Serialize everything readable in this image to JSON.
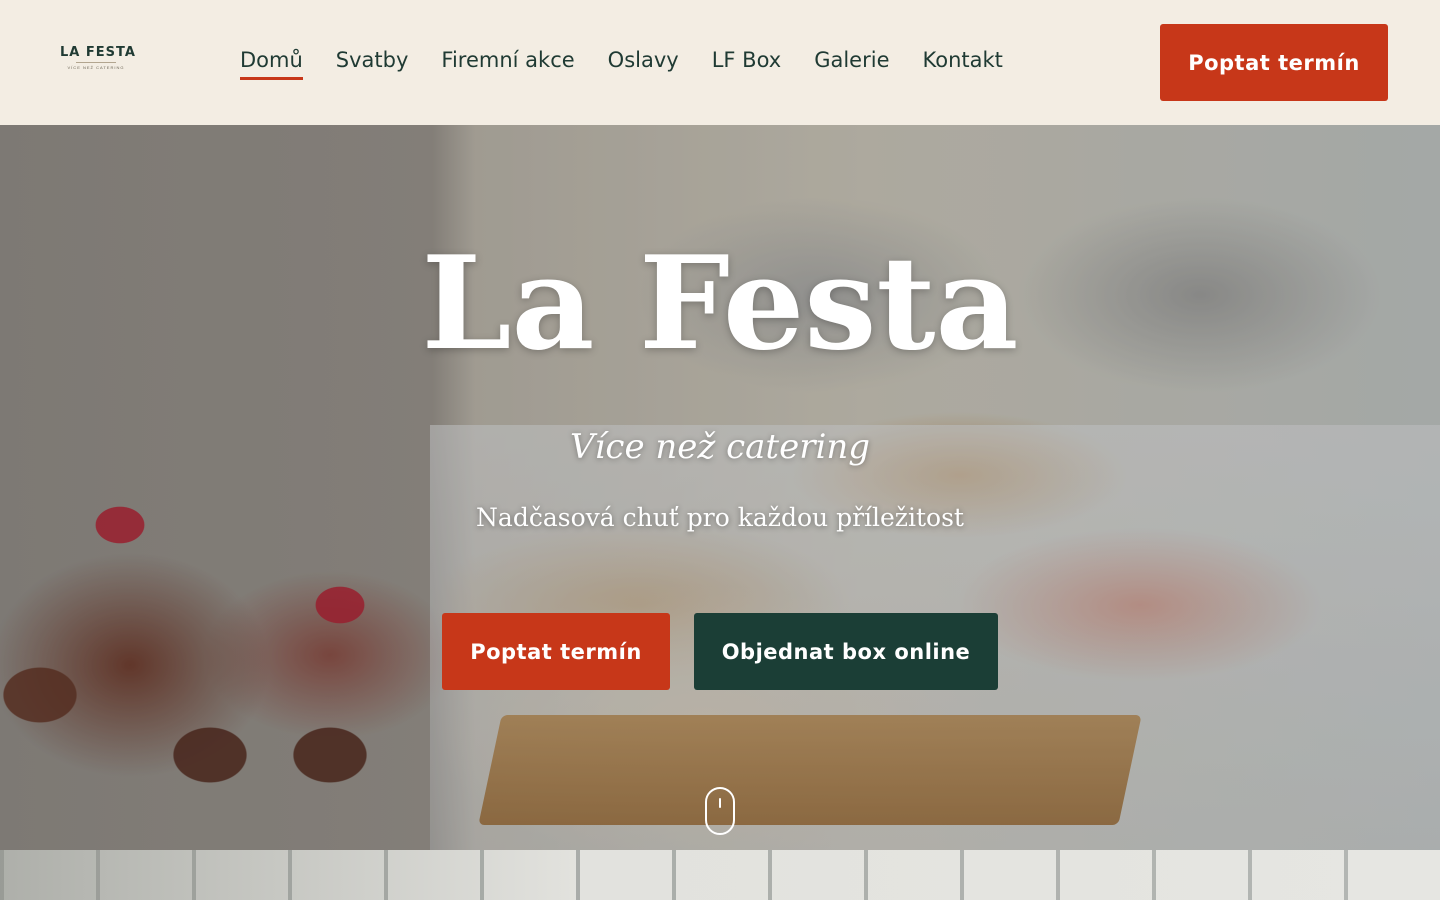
{
  "header": {
    "logo": {
      "name": "LA FESTA",
      "tagline": "VÍCE NEŽ CATERING"
    },
    "nav": [
      {
        "label": "Domů",
        "active": true
      },
      {
        "label": "Svatby"
      },
      {
        "label": "Firemní akce"
      },
      {
        "label": "Oslavy"
      },
      {
        "label": "LF Box"
      },
      {
        "label": "Galerie"
      },
      {
        "label": "Kontakt"
      }
    ],
    "cta_label": "Poptat termín"
  },
  "hero": {
    "title": "La Festa",
    "tagline": "Více než catering",
    "subtitle": "Nadčasová chuť pro každou příležitost",
    "primary_button": "Poptat termín",
    "secondary_button": "Objednat box online"
  },
  "colors": {
    "background": "#f3ede3",
    "accent_red": "#c73719",
    "dark_green": "#1b3e36",
    "nav_text": "#1f3a33"
  }
}
